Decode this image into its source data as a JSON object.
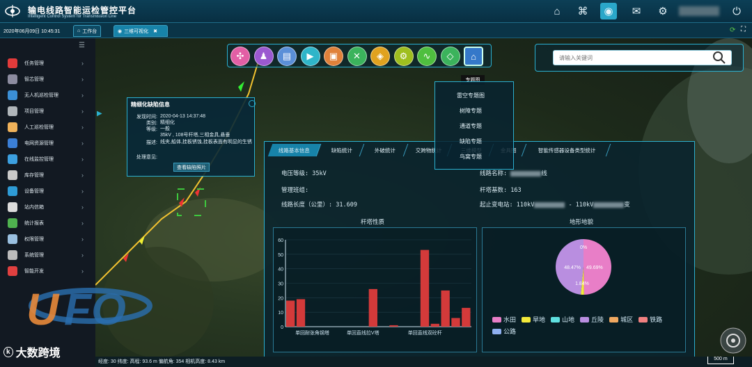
{
  "header": {
    "title": "输电线路智能运检管控平台",
    "subtitle": "Intelligent Control System for Transmission Line",
    "icons": [
      "home-icon",
      "network-icon",
      "globe-icon",
      "mail-icon",
      "gear-icon",
      "power-icon"
    ]
  },
  "tabbar": {
    "datetime": "2020年06月09日 10:45:31",
    "tabs": [
      {
        "label": "工作台",
        "icon": "home-icon"
      },
      {
        "label": "三维可视化",
        "icon": "globe-icon",
        "close": "✖"
      }
    ]
  },
  "sidebar": {
    "menu_icon": "☰",
    "items": [
      {
        "label": "任务管理",
        "color": "#e23b3b"
      },
      {
        "label": "智芯管理",
        "color": "#8c8ca0"
      },
      {
        "label": "无人机巡检管理",
        "color": "#3b8fd6"
      },
      {
        "label": "项目管理",
        "color": "#b0b6ba"
      },
      {
        "label": "人工巡检管理",
        "color": "#f0b25a"
      },
      {
        "label": "电网资源管理",
        "color": "#3b7fd6"
      },
      {
        "label": "在线监控管理",
        "color": "#3ca0e0"
      },
      {
        "label": "库存管理",
        "color": "#c9c9c9"
      },
      {
        "label": "设备管理",
        "color": "#2e9bd6"
      },
      {
        "label": "站内信箱",
        "color": "#dcdcdc"
      },
      {
        "label": "统计报表",
        "color": "#4fb24f"
      },
      {
        "label": "权限管理",
        "color": "#9ac0e0"
      },
      {
        "label": "系统管理",
        "color": "#bbbbbb"
      },
      {
        "label": "智能开发",
        "color": "#e04040"
      }
    ]
  },
  "toolbar": {
    "tools": [
      {
        "icon": "drone-icon",
        "color": "#e25fa5"
      },
      {
        "icon": "pin-icon",
        "color": "#9b59d0"
      },
      {
        "icon": "layers-icon",
        "color": "#5a8fd8"
      },
      {
        "icon": "video-icon",
        "color": "#2fb5c9"
      },
      {
        "icon": "photo-icon",
        "color": "#e0813a"
      },
      {
        "icon": "tools-icon",
        "color": "#3bb35c"
      },
      {
        "icon": "compass-icon",
        "color": "#e0a21f"
      },
      {
        "icon": "settings-icon",
        "color": "#9fbf1f"
      },
      {
        "icon": "chart-icon",
        "color": "#4fbf3f"
      },
      {
        "icon": "cube-icon",
        "color": "#3bb35c"
      },
      {
        "icon": "topic-map-icon",
        "color": "#3578c9"
      }
    ],
    "tooltip": "专题图"
  },
  "search": {
    "placeholder": "请输入关键词"
  },
  "topic_menu": {
    "items": [
      "雷空专题图",
      "树障专题",
      "通道专题",
      "缺陷专题",
      "鸟窝专题"
    ]
  },
  "defect_popup": {
    "title": "精细化缺陷信息",
    "fields": [
      {
        "label": "发现时间:",
        "value": "2020-04-13 14:37:48"
      },
      {
        "label": "类别:",
        "value": "精细化"
      },
      {
        "label": "等级:",
        "value": "一般"
      },
      {
        "label": "",
        "value": "35kV        , 108号杆塔,三相金具,悬垂"
      },
      {
        "label": "描述:",
        "value": "线夹,船体,挂板锈蚀,挂板表面有明显的生锈"
      },
      {
        "label": "处理意见:",
        "value": ""
      }
    ],
    "button": "查看缺陷照片"
  },
  "panel": {
    "tabs": [
      "线路基本信息",
      "缺陷统计",
      "外破统计",
      "交跨物统计",
      "三维模型",
      "金具图",
      "智能传感器设备类型统计"
    ],
    "info_left": [
      "电压等级: 35kV",
      "管理班组:",
      "线路长度（公里）: 31.609"
    ],
    "info_right": [
      {
        "prefix": "线路名称:",
        "suffix": "线"
      },
      {
        "prefix": "杆塔基数: 163",
        "suffix": ""
      },
      {
        "prefix": "起止变电站: 110kV",
        "suffix": "- 110kV",
        "end": "变"
      }
    ]
  },
  "chart_data": [
    {
      "type": "bar",
      "title": "杆塔性质",
      "ylim": [
        0,
        60
      ],
      "yticks": [
        0,
        10,
        20,
        30,
        40,
        50,
        60
      ],
      "tick_labels": [
        "单回耐张角钢塔",
        "单回直线拉V塔",
        "单回直线双砼杆"
      ],
      "values": [
        18,
        19,
        0,
        0,
        0,
        0,
        0,
        0,
        26,
        0,
        1,
        0,
        0,
        53,
        2,
        25,
        6,
        13
      ],
      "color": "#d33a3a"
    },
    {
      "type": "pie",
      "title": "地形地貌",
      "slices": [
        {
          "name": "水田",
          "value": 49.69,
          "label": "49.69%",
          "color": "#e87ec7"
        },
        {
          "name": "旱地",
          "value": 1.84,
          "label": "1.84%",
          "color": "#f3ea3a"
        },
        {
          "name": "山地",
          "value": 0,
          "label": "",
          "color": "#5fe0e0"
        },
        {
          "name": "丘陵",
          "value": 48.47,
          "label": "48.47%",
          "color": "#b98ee0"
        },
        {
          "name": "城区",
          "value": 0,
          "label": "0%",
          "color": "#f0a860"
        },
        {
          "name": "铁路",
          "value": 0,
          "label": "",
          "color": "#f08080"
        },
        {
          "name": "公路",
          "value": 0,
          "label": "",
          "color": "#8fb0f0"
        }
      ]
    }
  ],
  "bottom": {
    "coords": "经度:         30  纬度:           高程: 93.6 m  偏航角: 354  相机高度: 8.43 km",
    "brand": "大数跨境",
    "scale": "500 m"
  }
}
